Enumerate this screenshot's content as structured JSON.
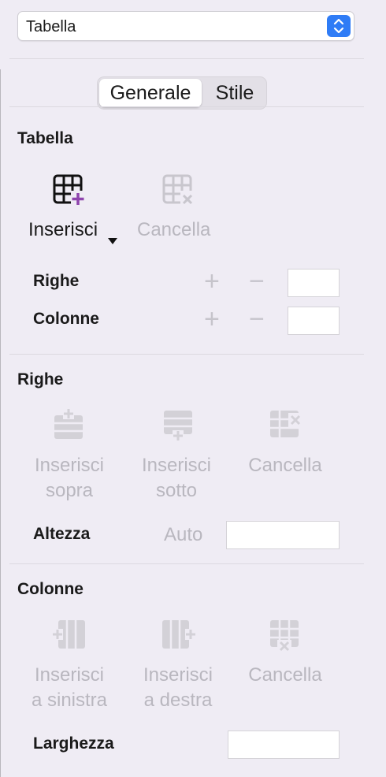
{
  "select": {
    "value": "Tabella"
  },
  "tabs": [
    {
      "label": "Generale",
      "active": true
    },
    {
      "label": "Stile",
      "active": false
    }
  ],
  "table_section": {
    "title": "Tabella",
    "insert_label": "Inserisci",
    "delete_label": "Cancella",
    "rows_label": "Righe",
    "cols_label": "Colonne",
    "plus": "+",
    "minus": "−"
  },
  "rows_section": {
    "title": "Righe",
    "insert_above": [
      "Inserisci",
      "sopra"
    ],
    "insert_below": [
      "Inserisci",
      "sotto"
    ],
    "delete_label": "Cancella",
    "height_label": "Altezza",
    "height_auto": "Auto"
  },
  "cols_section": {
    "title": "Colonne",
    "insert_left": [
      "Inserisci",
      "a sinistra"
    ],
    "insert_right": [
      "Inserisci",
      "a destra"
    ],
    "delete_label": "Cancella",
    "width_label": "Larghezza"
  },
  "colors": {
    "accent": "#2f7cf6",
    "insert_plus": "#8e44ad",
    "disabled": "#b9b7bf"
  }
}
